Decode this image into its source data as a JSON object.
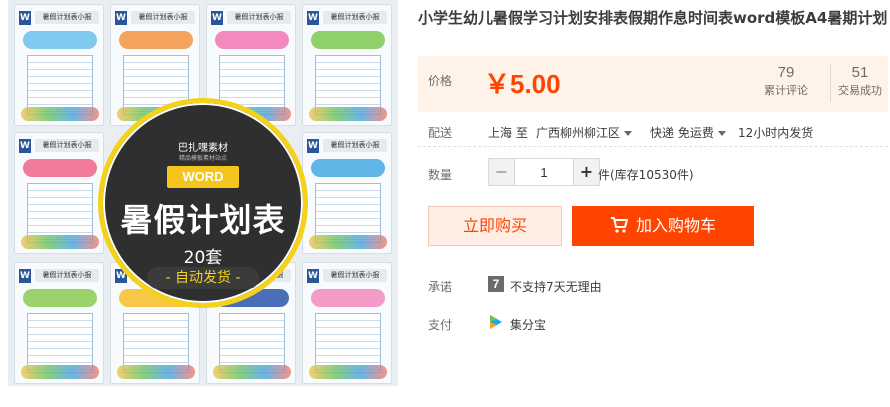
{
  "product": {
    "title": "小学生幼儿暑假学习计划安排表假期作息时间表word模板A4暑期计划",
    "image": {
      "brand": "巴扎嘿素材",
      "brand_sub": "精品模板素材站点",
      "tag": "WORD",
      "headline": "暑假计划表",
      "count": "20套",
      "shipping": "- 自动发货 -",
      "thumb_label": "暑假计划表小报",
      "word_badge": "W"
    }
  },
  "price": {
    "label": "价格",
    "value": "￥5.00",
    "reviews_count": "79",
    "reviews_label": "累计评论",
    "sales_count": "51",
    "sales_label": "交易成功"
  },
  "shipping": {
    "label": "配送",
    "from": "上海 至",
    "to": "广西柳州柳江区",
    "method": "快递 免运费",
    "dispatch": "12小时内发货"
  },
  "quantity": {
    "label": "数量",
    "value": "1",
    "minus": "−",
    "plus": "+",
    "stock": "件(库存10530件)"
  },
  "actions": {
    "buy_now": "立即购买",
    "add_to_cart": "加入购物车"
  },
  "promise": {
    "label": "承诺",
    "icon_text": "7",
    "text": "不支持7天无理由"
  },
  "payment": {
    "label": "支付",
    "method": "集分宝"
  },
  "colors": {
    "accent": "#ff4400",
    "price_bg": "#fff2e8",
    "promo_ring": "#f4d21c"
  }
}
